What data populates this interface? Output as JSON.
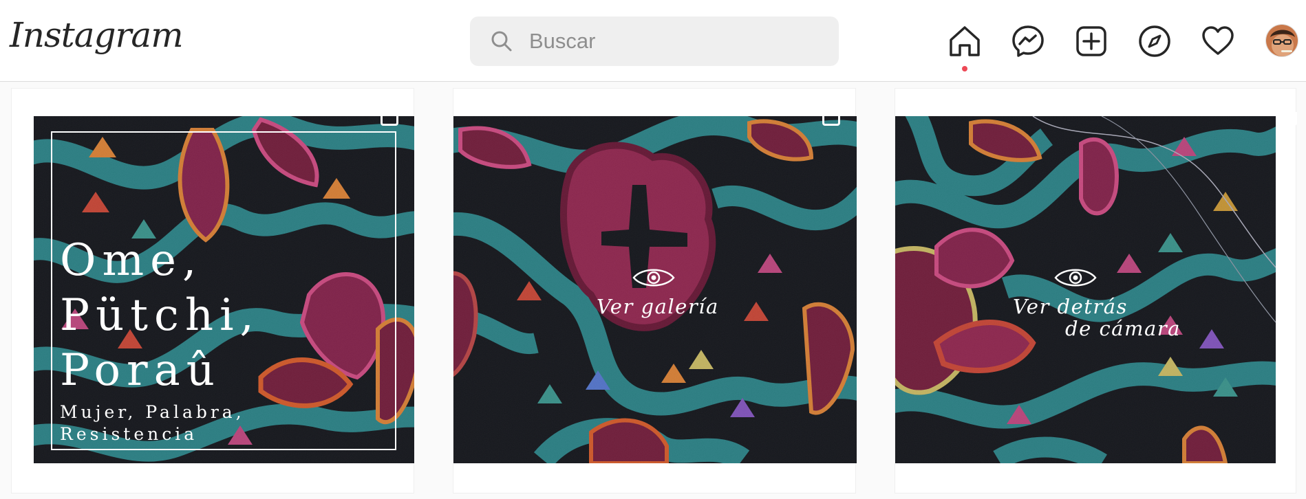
{
  "header": {
    "logo": "Instagram",
    "search_placeholder": "Buscar"
  },
  "icons": {
    "home": "home-icon",
    "messenger": "messenger-icon",
    "new_post": "plus-square-icon",
    "explore": "compass-icon",
    "activity": "heart-icon",
    "profile": "avatar"
  },
  "colors": {
    "notification_dot": "#ed4956",
    "fabric_teal": "#2f8a8f",
    "fabric_dark": "#15171d",
    "fabric_magenta": "#8c2550"
  },
  "posts": [
    {
      "title_lines": [
        "Ome,",
        "Pütchi,",
        "Poraû"
      ],
      "subtitle_lines": [
        "Mujer, Palabra,",
        "Resistencia"
      ]
    },
    {
      "label": "Ver galería"
    },
    {
      "label_lines": [
        "Ver detrás",
        "de cámara"
      ]
    }
  ]
}
